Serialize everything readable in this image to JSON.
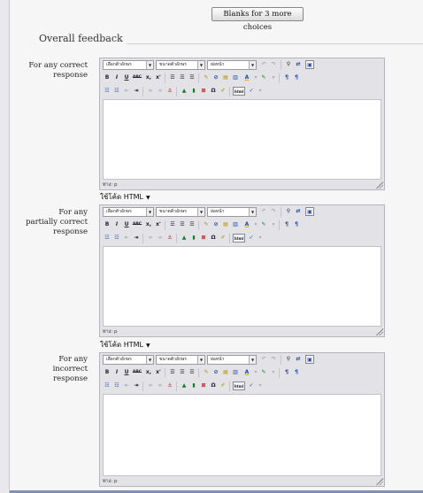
{
  "header": {
    "blanks_button": "Blanks for 3 more choices"
  },
  "section": {
    "legend": "Overall feedback"
  },
  "editors": [
    {
      "label": "For any correct response",
      "path": "ทาง: p",
      "format": "ใช้โค้ด HTML"
    },
    {
      "label": "For any partially correct response",
      "path": "ทาง: p",
      "format": "ใช้โค้ด HTML"
    },
    {
      "label": "For any incorrect response",
      "path": "ทาง: p",
      "format": ""
    }
  ],
  "toolbar": {
    "font_family": "เลือกตัวอักษร",
    "font_size": "ขนาดตัวอักษร",
    "heading": "ย่อหน้า",
    "bold": "B",
    "italic": "I",
    "underline": "U",
    "strike": "ABC",
    "subscript": "x,",
    "superscript": "x'",
    "text_color": "A",
    "ltr": "¶",
    "rtl": "¶",
    "omega": "Ω",
    "html": "html"
  },
  "icons": [
    "undo-icon",
    "redo-icon",
    "find-icon",
    "replace-icon",
    "fullscreen-icon",
    "align-left-icon",
    "align-center-icon",
    "align-right-icon",
    "clean-icon",
    "spellcheck-icon",
    "paste-text-icon",
    "paste-word-icon",
    "text-color-icon",
    "highlight-icon",
    "ltr-icon",
    "rtl-icon",
    "bullet-list-icon",
    "number-list-icon",
    "outdent-icon",
    "indent-icon",
    "link-icon",
    "unlink-icon",
    "anchor-icon",
    "image-icon",
    "media-icon",
    "nonbreaking-icon",
    "special-char-icon",
    "cleanup-icon",
    "html-icon",
    "spellcheck-dropdown-icon"
  ]
}
